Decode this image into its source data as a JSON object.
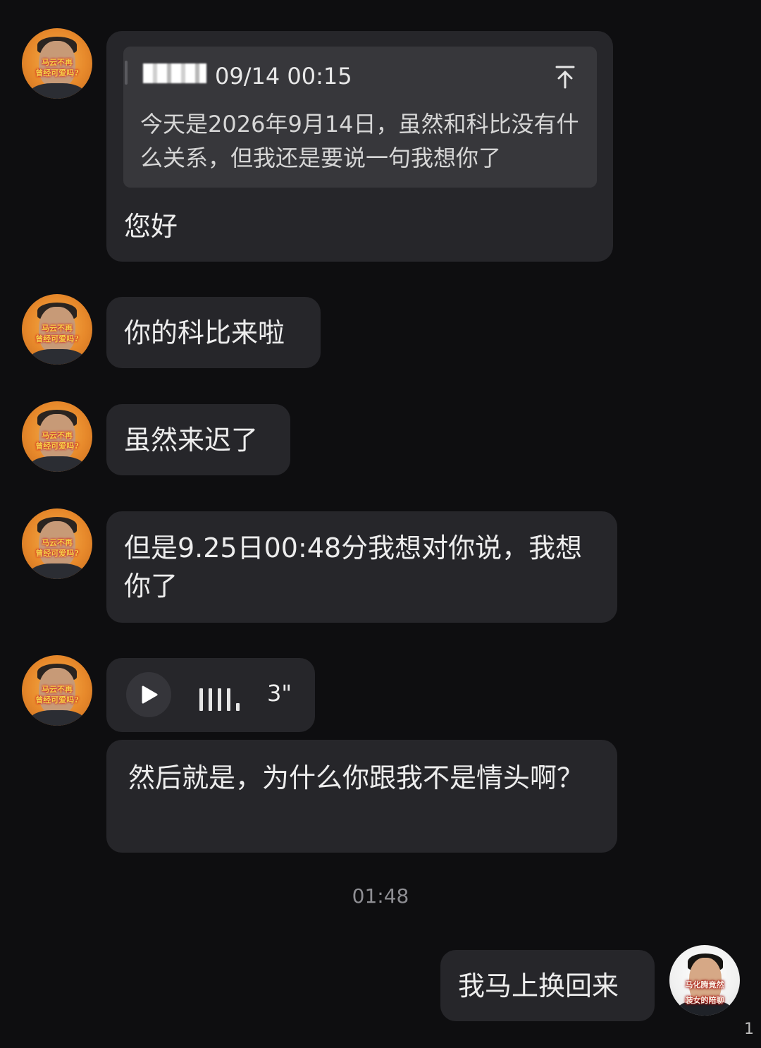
{
  "messages": [
    {
      "sender": "other",
      "quote": {
        "time": "09/14 00:15",
        "text": "今天是2026年9月14日，虽然和科比没有什么关系，但我还是要说一句我想你了",
        "icon": "scroll-to-top-icon"
      },
      "text": "您好"
    },
    {
      "sender": "other",
      "text": "你的科比来啦"
    },
    {
      "sender": "other",
      "text": "虽然来迟了"
    },
    {
      "sender": "other",
      "text": "但是9.25日00:48分我想对你说，我想你了"
    },
    {
      "sender": "other",
      "type": "voice",
      "duration": "3\"",
      "icon": "play-icon"
    },
    {
      "sender": "other",
      "text": "然后就是，为什么你跟我不是情头啊？"
    },
    {
      "sender": "me",
      "text": "我马上换回来"
    }
  ],
  "time_divider": "01:48",
  "avatars": {
    "other": {
      "stamp_line1": "马云不再",
      "stamp_line2": "曾经可爱吗?"
    },
    "me": {
      "stamp_line1": "马化腾竟然",
      "stamp_line2": "装女的陪聊"
    }
  },
  "edge_mark": "1"
}
